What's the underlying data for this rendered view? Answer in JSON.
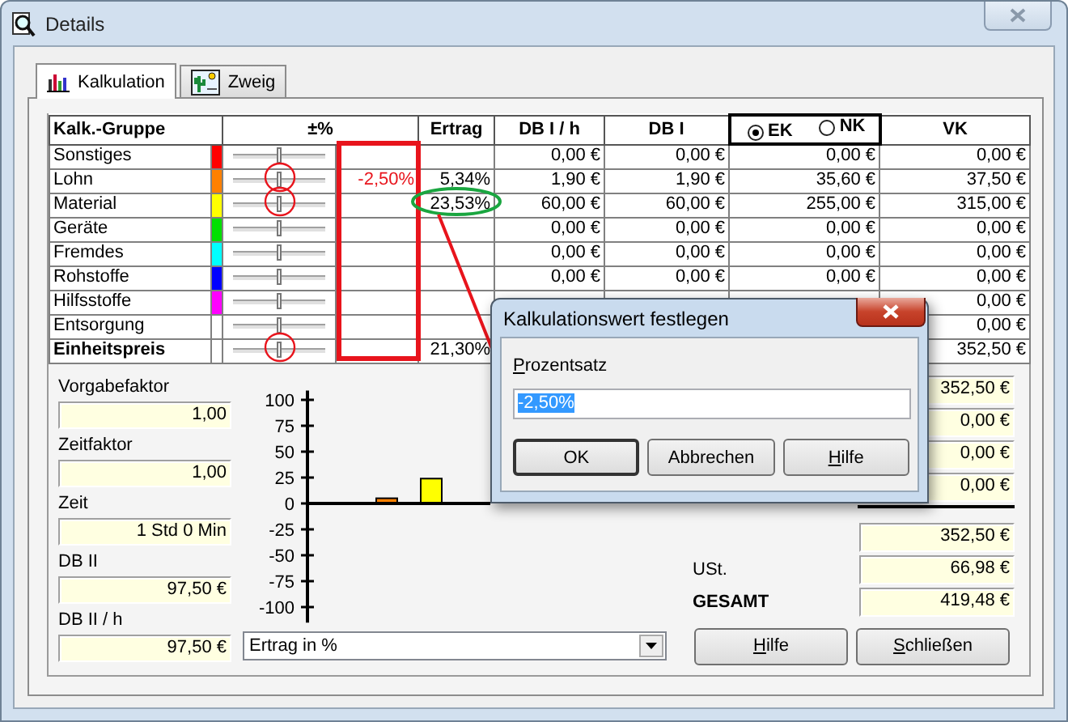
{
  "window": {
    "title": "Details"
  },
  "tabs": [
    {
      "label": "Kalkulation",
      "kind": "chart",
      "selected": true
    },
    {
      "label": "Zweig",
      "kind": "landscape",
      "selected": false
    }
  ],
  "table": {
    "columns": [
      {
        "kind": "text",
        "label": "Kalk.-Gruppe"
      },
      {
        "kind": "text",
        "label": "±%"
      },
      {
        "kind": "text",
        "label": "Ertrag"
      },
      {
        "kind": "text",
        "label": "DB I / h"
      },
      {
        "kind": "text",
        "label": "DB I"
      },
      {
        "kind": "radio",
        "options": [
          {
            "label": "EK",
            "selected": true
          },
          {
            "label": "NK",
            "selected": false
          }
        ]
      },
      {
        "kind": "text",
        "label": "VK"
      }
    ],
    "rows": [
      {
        "kind": "group",
        "group": "Sonstiges",
        "color": "#ff0000",
        "level": 0.5,
        "circled": false,
        "highlighted": false,
        "db_h": "0,00 €",
        "db": "0,00 €",
        "ek": "0,00 €",
        "vk": "0,00 €"
      },
      {
        "kind": "group",
        "group": "Lohn",
        "color": "#ff8000",
        "level": 0.5,
        "circled": true,
        "highlighted": false,
        "percent": "-2,50%",
        "ertrag": "5,34%",
        "db_h": "1,90 €",
        "db": "1,90 €",
        "ek": "35,60 €",
        "vk": "37,50 €"
      },
      {
        "kind": "group",
        "group": "Material",
        "color": "#ffff00",
        "level": 0.5,
        "circled": true,
        "highlighted": true,
        "ertrag": "23,53%",
        "db_h": "60,00 €",
        "db": "60,00 €",
        "ek": "255,00 €",
        "vk": "315,00 €"
      },
      {
        "kind": "group",
        "group": "Geräte",
        "color": "#00e000",
        "level": 0.5,
        "circled": false,
        "highlighted": false,
        "db_h": "0,00 €",
        "db": "0,00 €",
        "ek": "0,00 €",
        "vk": "0,00 €"
      },
      {
        "kind": "group",
        "group": "Fremdes",
        "color": "#00ffff",
        "level": 0.5,
        "circled": false,
        "highlighted": false,
        "db_h": "0,00 €",
        "db": "0,00 €",
        "ek": "0,00 €",
        "vk": "0,00 €"
      },
      {
        "kind": "group",
        "group": "Rohstoffe",
        "color": "#0000ff",
        "level": 0.5,
        "circled": false,
        "highlighted": false,
        "db_h": "0,00 €",
        "db": "0,00 €",
        "ek": "0,00 €",
        "vk": "0,00 €"
      },
      {
        "kind": "group",
        "group": "Hilfsstoffe",
        "color": "#ff00ff",
        "level": 0.5,
        "circled": false,
        "highlighted": false,
        "vk": "0,00 €"
      },
      {
        "kind": "group",
        "group": "Entsorgung",
        "color": "#ffffff",
        "level": 0.5,
        "circled": false,
        "highlighted": false,
        "vk": "0,00 €"
      },
      {
        "kind": "total",
        "group": "Einheitspreis",
        "color": "#ffffff",
        "level": 0.5,
        "circled": true,
        "highlighted": false,
        "ertrag": "21,30%",
        "vk": "352,50 €"
      }
    ]
  },
  "fields": [
    {
      "label": "Vorgabefaktor",
      "value": "1,00"
    },
    {
      "label": "Zeitfaktor",
      "value": "1,00"
    },
    {
      "label": "Zeit",
      "value": "1 Std 0 Min"
    },
    {
      "label": "DB II",
      "value": "97,50 €"
    },
    {
      "label": "DB II / h",
      "value": "97,50 €"
    }
  ],
  "chart": {
    "chart_data": {
      "type": "bar",
      "ylim": [
        -115,
        109
      ],
      "yticks": [
        100,
        75,
        50,
        25,
        0,
        -25,
        -50,
        -75,
        -100
      ],
      "values": [
        5,
        24
      ]
    },
    "selector": {
      "value": "Ertrag in %"
    }
  },
  "totals": [
    {
      "value": "352,50 €"
    },
    {
      "value": "0,00 €"
    },
    {
      "value": "0,00 €"
    },
    {
      "value": "0,00 €"
    }
  ],
  "summary": [
    {
      "kind": "plain",
      "value": "352,50 €"
    },
    {
      "kind": "plain",
      "label": "USt.",
      "value": "66,98 €"
    },
    {
      "kind": "grand",
      "label": "GESAMT",
      "value": "419,48 €"
    }
  ],
  "buttons": [
    {
      "label": "Hilfe",
      "mnemonic": true
    },
    {
      "label": "Schließen",
      "mnemonic": true
    }
  ],
  "dialog": {
    "title": "Kalkulationswert festlegen",
    "field": {
      "label": "Prozentsatz",
      "mnemonic": true,
      "value": "-2,50%",
      "text_selected": true
    },
    "buttons": [
      {
        "label": "OK",
        "default": true,
        "mnemonic": false
      },
      {
        "label": "Abbrechen",
        "default": false,
        "mnemonic": false
      },
      {
        "label": "Hilfe",
        "default": false,
        "mnemonic": true
      }
    ]
  }
}
